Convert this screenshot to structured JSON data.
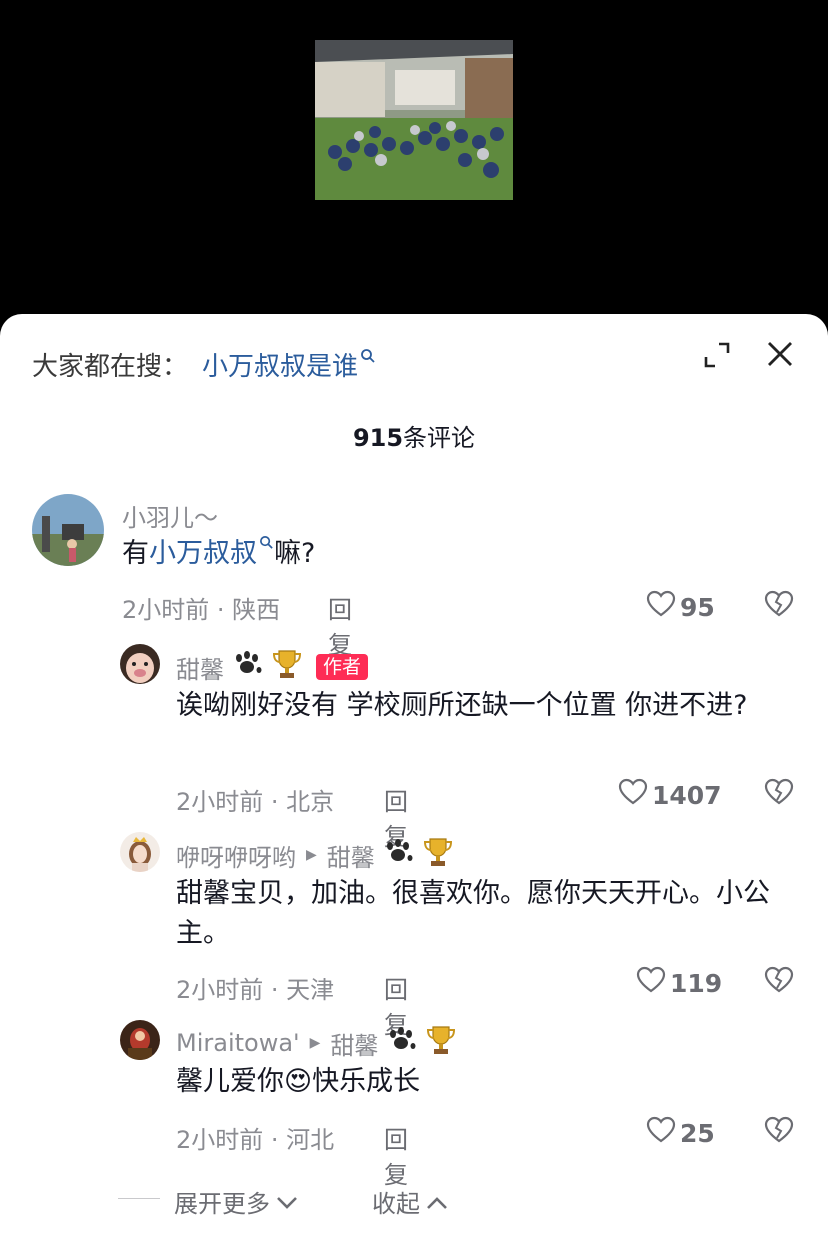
{
  "search": {
    "prefix": "大家都在搜：",
    "term": "小万叔叔是谁"
  },
  "comment_count": {
    "number": "915",
    "unit": "条评论"
  },
  "comments": [
    {
      "username": "小羽儿～",
      "text_before": "有",
      "text_link": "小万叔叔",
      "text_after": "嘛?",
      "meta": "2小时前 · 陕西",
      "reply": "回复",
      "likes": "95"
    },
    {
      "username": "甜馨",
      "badge": "作者",
      "text": "诶呦刚好没有 学校厕所还缺一个位置 你进不进?",
      "meta": "2小时前 · 北京",
      "reply": "回复",
      "likes": "1407"
    },
    {
      "username": "咿呀咿呀哟",
      "reply_to": "甜馨",
      "text": "甜馨宝贝，加油。很喜欢你。愿你天天开心。小公主。",
      "meta": "2小时前 · 天津",
      "reply": "回复",
      "likes": "119"
    },
    {
      "username": "Miraitowa'",
      "reply_to": "甜馨",
      "text_before": "馨儿爱你",
      "emoji": "😍",
      "text_after": "快乐成长",
      "meta": "2小时前 · 河北",
      "reply": "回复",
      "likes": "25"
    }
  ],
  "footer": {
    "expand_more": "展开更多",
    "collapse": "收起"
  },
  "icons": {
    "close": "close-icon",
    "expand": "expand-icon",
    "like": "heart-outline-icon",
    "dislike": "broken-heart-icon",
    "paw": "paw-icon",
    "trophy": "trophy-icon"
  },
  "colors": {
    "link": "#2b5c9c",
    "author_badge": "#fe2c55",
    "muted": "#8a8b91"
  }
}
